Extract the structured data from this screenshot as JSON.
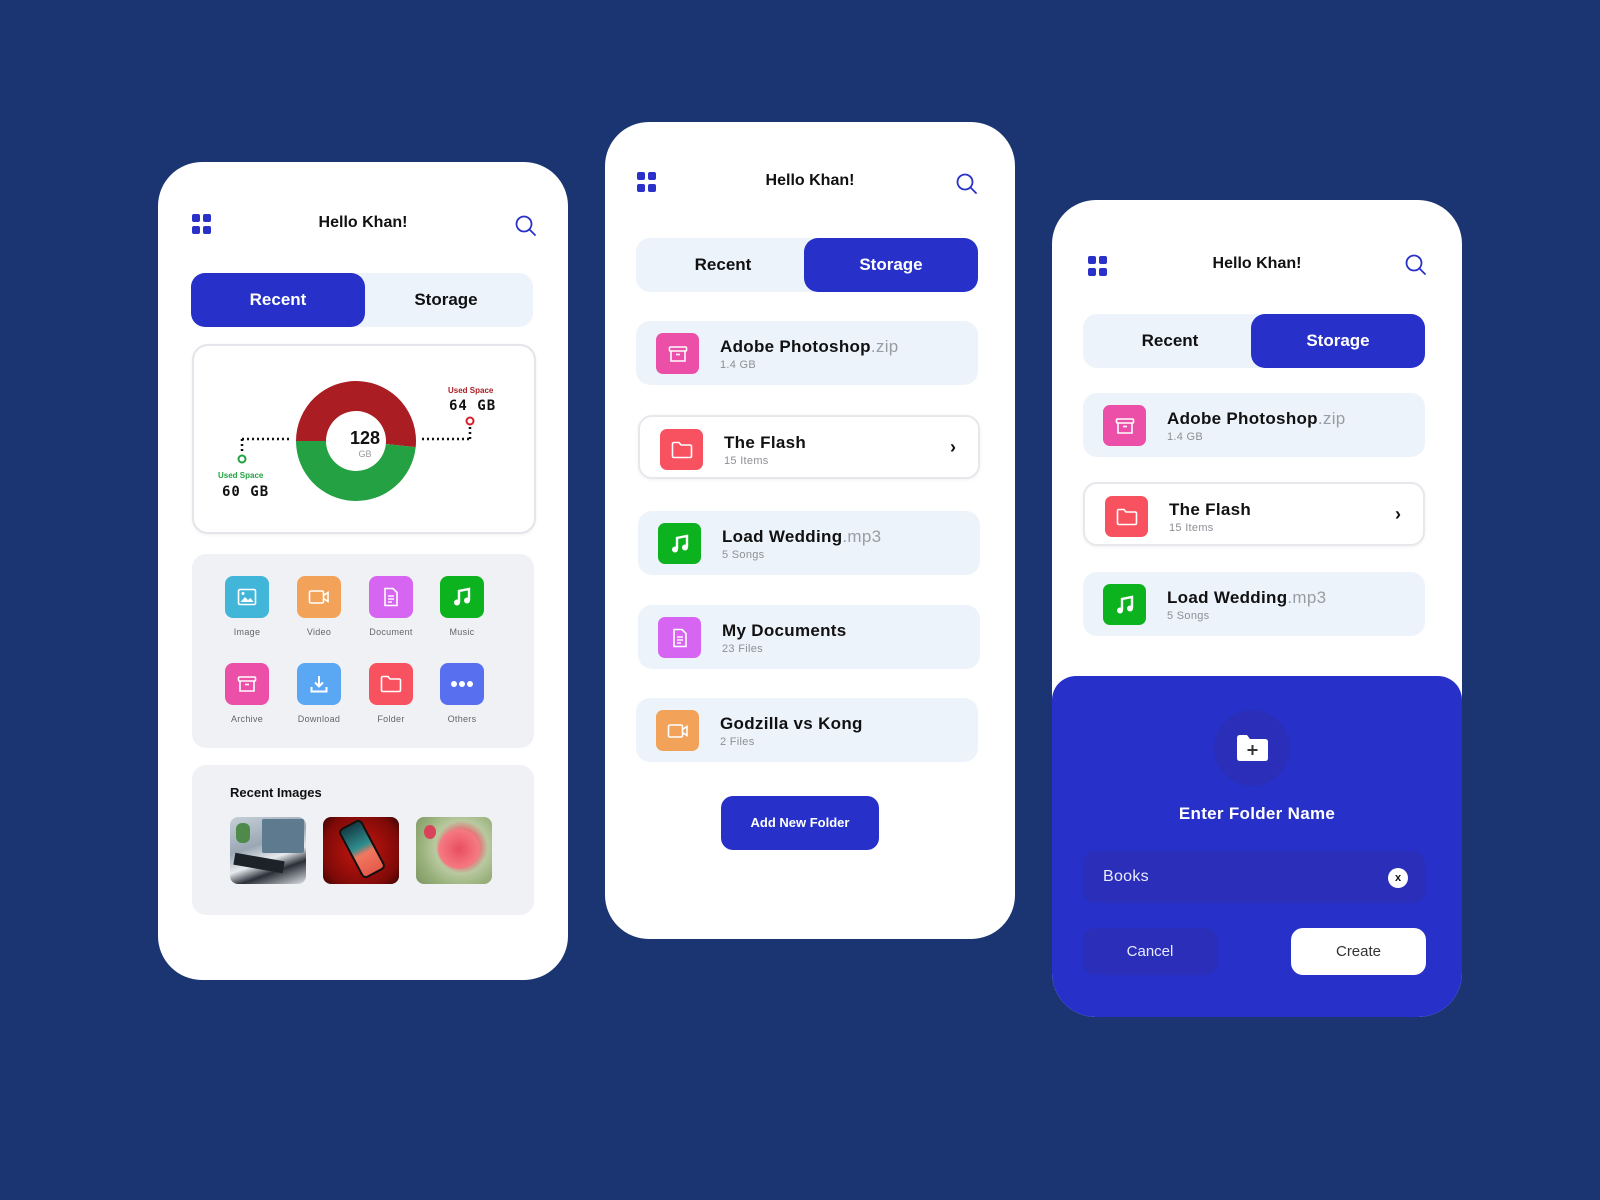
{
  "colors": {
    "background": "#1b3572",
    "accent": "#2730c9",
    "used_red": "#a91d23",
    "used_green": "#23a143",
    "tile_image": "#41b6d9",
    "tile_video": "#f3a25a",
    "tile_document": "#d665f1",
    "tile_music": "#0db31f",
    "tile_archive": "#ec4fa7",
    "tile_download": "#5aa8f3",
    "tile_folder": "#f8515f",
    "tile_others": "#5870ef"
  },
  "header": {
    "greeting": "Hello Khan!",
    "menu_icon": "grid-icon",
    "search_icon": "search-icon"
  },
  "tabs": {
    "recent": "Recent",
    "storage": "Storage"
  },
  "screen1": {
    "active_tab": "recent",
    "storage_chart": {
      "total_value": "128",
      "total_unit": "GB",
      "segments": [
        {
          "label": "Used Space",
          "value_label": "64 GB",
          "value": 64,
          "color": "#a91d23",
          "side": "right"
        },
        {
          "label": "Used Space",
          "value_label": "60 GB",
          "value": 60,
          "color": "#23a143",
          "side": "left"
        }
      ]
    },
    "categories": [
      {
        "label": "Image",
        "icon": "image-icon"
      },
      {
        "label": "Video",
        "icon": "video-icon"
      },
      {
        "label": "Document",
        "icon": "document-icon"
      },
      {
        "label": "Music",
        "icon": "music-icon"
      },
      {
        "label": "Archive",
        "icon": "archive-icon"
      },
      {
        "label": "Download",
        "icon": "download-icon"
      },
      {
        "label": "Folder",
        "icon": "folder-icon"
      },
      {
        "label": "Others",
        "icon": "more-icon"
      }
    ],
    "recent_images": {
      "title": "Recent Images",
      "items": [
        {
          "alt": "Desk with keyboard and monitor"
        },
        {
          "alt": "Smartphone on red background"
        },
        {
          "alt": "Pink rose"
        }
      ]
    }
  },
  "screen2": {
    "active_tab": "storage",
    "files": [
      {
        "name": "Adobe Photoshop",
        "ext": ".zip",
        "sub": "1.4 GB",
        "icon": "archive-icon"
      },
      {
        "name": "The Flash",
        "ext": "",
        "sub": "15 Items",
        "icon": "folder-icon",
        "selected": true
      },
      {
        "name": "Load Wedding",
        "ext": ".mp3",
        "sub": "5 Songs",
        "icon": "music-icon"
      },
      {
        "name": "My Documents",
        "ext": "",
        "sub": "23 Files",
        "icon": "document-icon"
      },
      {
        "name": "Godzilla vs Kong",
        "ext": "",
        "sub": "2 Files",
        "icon": "video-icon"
      }
    ],
    "add_button": "Add New Folder"
  },
  "screen3": {
    "active_tab": "storage",
    "dialog": {
      "title": "Enter Folder Name",
      "input_value": "Books",
      "clear_label": "x",
      "cancel": "Cancel",
      "create": "Create"
    }
  }
}
